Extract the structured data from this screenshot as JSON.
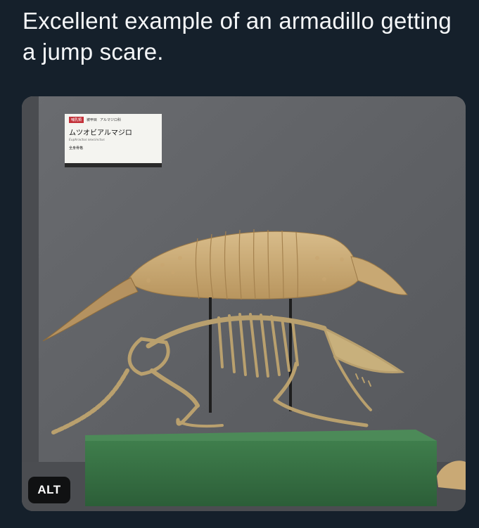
{
  "post": {
    "text": "Excellent example of an armadillo getting a jump scare."
  },
  "media": {
    "alt_badge": "ALT",
    "exhibit_label": {
      "tag_category": "哺乳類",
      "tag_order": "被甲目",
      "tag_family": "アルマジロ科",
      "name_japanese": "ムツオビアルマジロ",
      "name_scientific": "Euphractus sexcinctus",
      "note": "全身骨格"
    }
  },
  "colors": {
    "background": "#15202b",
    "text": "#f5f7f9",
    "badge_bg": "#000000"
  }
}
